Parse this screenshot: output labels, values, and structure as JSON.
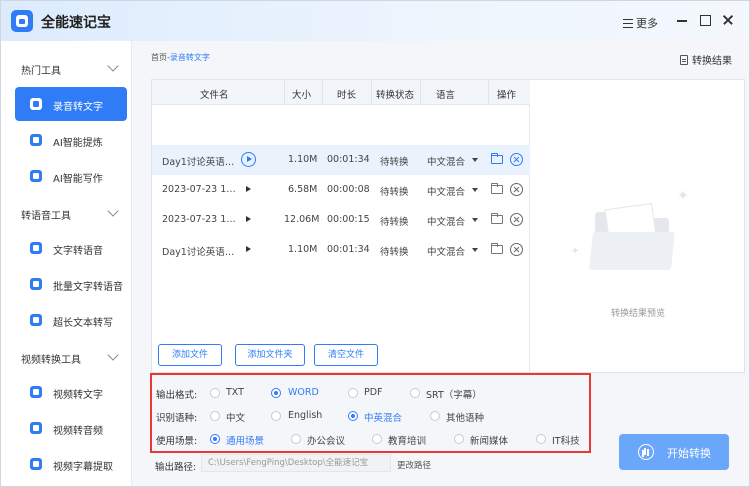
{
  "app": {
    "title": "全能速记宝",
    "more_label": "更多"
  },
  "sidebar": {
    "groups": [
      {
        "label": "热门工具",
        "items": [
          {
            "label": "录音转文字"
          },
          {
            "label": "AI智能提炼"
          },
          {
            "label": "AI智能写作"
          }
        ]
      },
      {
        "label": "转语音工具",
        "items": [
          {
            "label": "文字转语音"
          },
          {
            "label": "批量文字转语音"
          },
          {
            "label": "超长文本转写"
          }
        ]
      },
      {
        "label": "视频转换工具",
        "items": [
          {
            "label": "视频转文字"
          },
          {
            "label": "视频转音频"
          },
          {
            "label": "视频字幕提取"
          }
        ]
      }
    ],
    "active_item": "录音转文字"
  },
  "breadcrumb": {
    "home": "首页",
    "separator": "-",
    "current": "录音转文字"
  },
  "results_link": "转换结果",
  "table": {
    "headers": [
      "文件名",
      "大小",
      "时长",
      "转换状态",
      "语言",
      "操作"
    ],
    "rows": [
      {
        "name": "Day1讨论英语…",
        "size": "1.10M",
        "duration": "00:01:34",
        "status": "待转换",
        "language": "中文混合"
      },
      {
        "name": "2023-07-23 1…",
        "size": "6.58M",
        "duration": "00:00:08",
        "status": "待转换",
        "language": "中文混合"
      },
      {
        "name": "2023-07-23 1…",
        "size": "12.06M",
        "duration": "00:00:15",
        "status": "待转换",
        "language": "中文混合"
      },
      {
        "name": "Day1讨论英语…",
        "size": "1.10M",
        "duration": "00:01:34",
        "status": "待转换",
        "language": "中文混合"
      }
    ]
  },
  "buttons": {
    "add_file": "添加文件",
    "add_folder": "添加文件夹",
    "clear": "清空文件"
  },
  "preview": {
    "placeholder": "转换结果预览"
  },
  "options": {
    "format": {
      "label": "输出格式:",
      "choices": [
        "TXT",
        "WORD",
        "PDF",
        "SRT（字幕）"
      ],
      "selected": "WORD"
    },
    "language": {
      "label": "识别语种:",
      "choices": [
        "中文",
        "English",
        "中英混合",
        "其他语种"
      ],
      "selected": "中英混合"
    },
    "scene": {
      "label": "使用场景:",
      "choices": [
        "通用场景",
        "办公会议",
        "教育培训",
        "新闻媒体",
        "IT科技"
      ],
      "selected": "通用场景"
    }
  },
  "output": {
    "label": "输出路径:",
    "path": "C:\\Users\\FengPing\\Desktop\\全能速记宝",
    "change": "更改路径"
  },
  "start_button": "开始转换",
  "colors": {
    "accent": "#2f7cf6",
    "start_button": "#6aa7fb",
    "highlight_border": "#e53935"
  }
}
